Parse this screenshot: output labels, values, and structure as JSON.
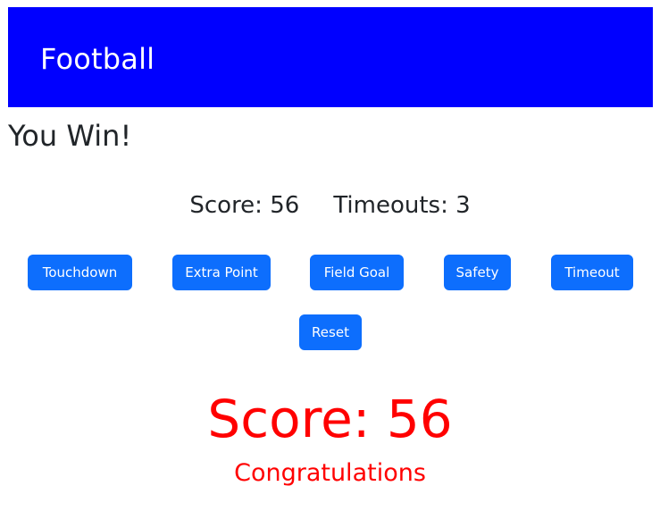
{
  "header": {
    "title": "Football",
    "bg_color": "#0000ff"
  },
  "result": {
    "title": "You Win!"
  },
  "status": {
    "score_label": "Score:",
    "score_value": "56",
    "timeouts_label": "Timeouts:",
    "timeouts_value": "3"
  },
  "buttons": {
    "touchdown": "Touchdown",
    "extra_point": "Extra Point",
    "field_goal": "Field Goal",
    "safety": "Safety",
    "timeout": "Timeout",
    "reset": "Reset",
    "color": "#0d6efd"
  },
  "final": {
    "score_label": "Score:",
    "score_value": "56",
    "message": "Congratulations",
    "color": "#ff0000"
  }
}
